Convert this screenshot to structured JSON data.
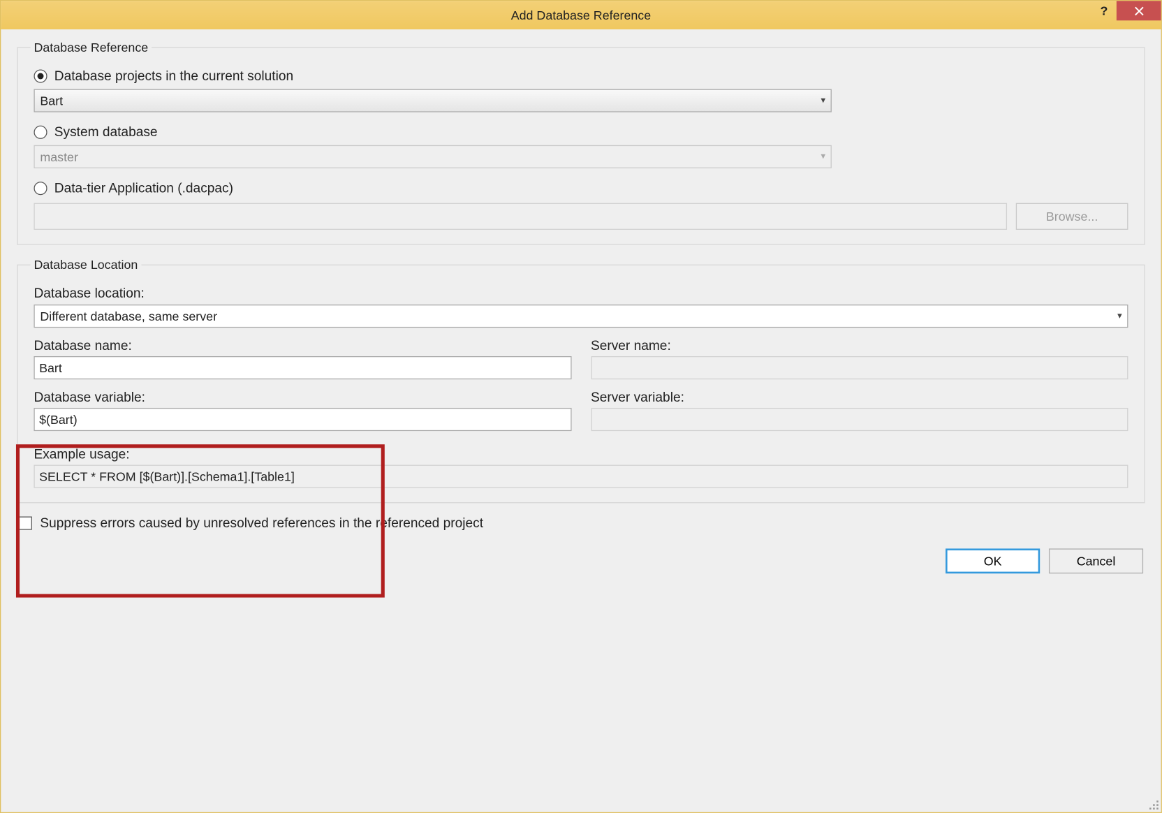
{
  "title": "Add Database Reference",
  "help_char": "?",
  "group_reference": {
    "legend": "Database Reference",
    "opt_projects_label": "Database projects in the current solution",
    "projects_value": "Bart",
    "opt_system_label": "System database",
    "system_value": "master",
    "opt_dacpac_label": "Data-tier Application (.dacpac)",
    "browse_label": "Browse..."
  },
  "group_location": {
    "legend": "Database Location",
    "location_label": "Database location:",
    "location_value": "Different database, same server",
    "dbname_label": "Database name:",
    "dbname_value": "Bart",
    "servername_label": "Server name:",
    "servername_value": "",
    "dbvar_label": "Database variable:",
    "dbvar_value": "$(Bart)",
    "servervar_label": "Server variable:",
    "servervar_value": "",
    "example_label": "Example usage:",
    "example_value": "SELECT * FROM [$(Bart)].[Schema1].[Table1]"
  },
  "suppress_label": "Suppress errors caused by unresolved references in the referenced project",
  "ok_label": "OK",
  "cancel_label": "Cancel"
}
